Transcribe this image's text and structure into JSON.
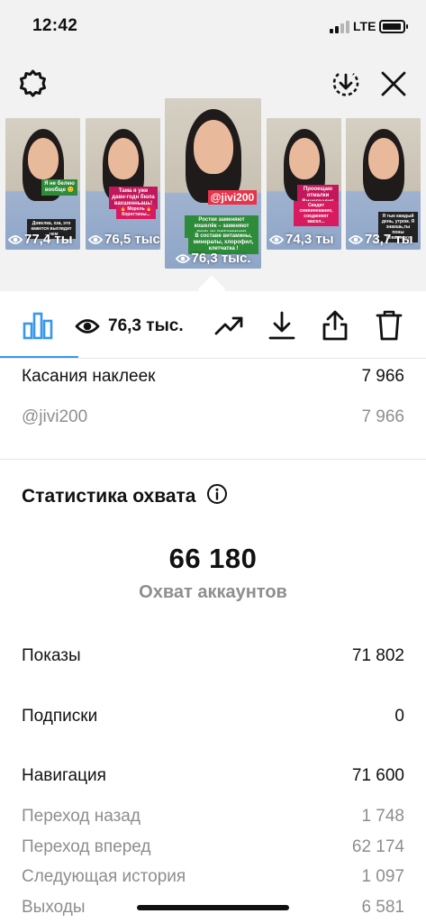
{
  "status_bar": {
    "time": "12:42",
    "network": "LTE"
  },
  "thumbnails": [
    {
      "views": "77,4 ты",
      "sticker_1": "Я не белею вообще 🙂",
      "sticker_2": "Довелка, хза, это кажется выглядит ... чем"
    },
    {
      "views": "76,5 тыс.",
      "sticker_1": "Тама я уже давн-годн бюла вахшенньаць!",
      "sticker_2": "🔥 Морель 🔥 Корнттины..."
    },
    {
      "views": "76,3 тыс.",
      "mention": "@jivi200",
      "sticker_1": "Ростки заменяют кошелёк – заменяют пользу витаминов",
      "sticker_2": "В составе витамины, минералы, хлорофил, клетчатка !"
    },
    {
      "views": "74,3 ты",
      "sticker_1": "Прооещаю отмалки Виноградит",
      "sticker_2": "Свадит семяиневание, соединяют масел..."
    },
    {
      "views": "73,7 ты",
      "sticker_1": "Я тык каждый день, утром. Я знаешь,ты поны повщаюжу"
    }
  ],
  "toolbar": {
    "views": "76,3 тыс."
  },
  "sticker_taps": {
    "label": "Касания наклеек",
    "value": "7 966",
    "mention_label": "@jivi200",
    "mention_value": "7 966"
  },
  "reach": {
    "title": "Статистика охвата",
    "accounts_reached": "66 180",
    "accounts_reached_label": "Охват аккаунтов",
    "impressions_label": "Показы",
    "impressions_value": "71 802",
    "follows_label": "Подписки",
    "follows_value": "0",
    "navigation_label": "Навигация",
    "navigation_value": "71 600",
    "back_label": "Переход назад",
    "back_value": "1 748",
    "forward_label": "Переход вперед",
    "forward_value": "62 174",
    "next_story_label": "Следующая история",
    "next_story_value": "1 097",
    "exits_label": "Выходы",
    "exits_value": "6 581"
  },
  "colors": {
    "accent": "#3797f0",
    "muted": "#8e8e8e",
    "top_background": "#f2f2f2",
    "mention_sticker": "#e8334a",
    "green_sticker": "#2e8b3a"
  }
}
